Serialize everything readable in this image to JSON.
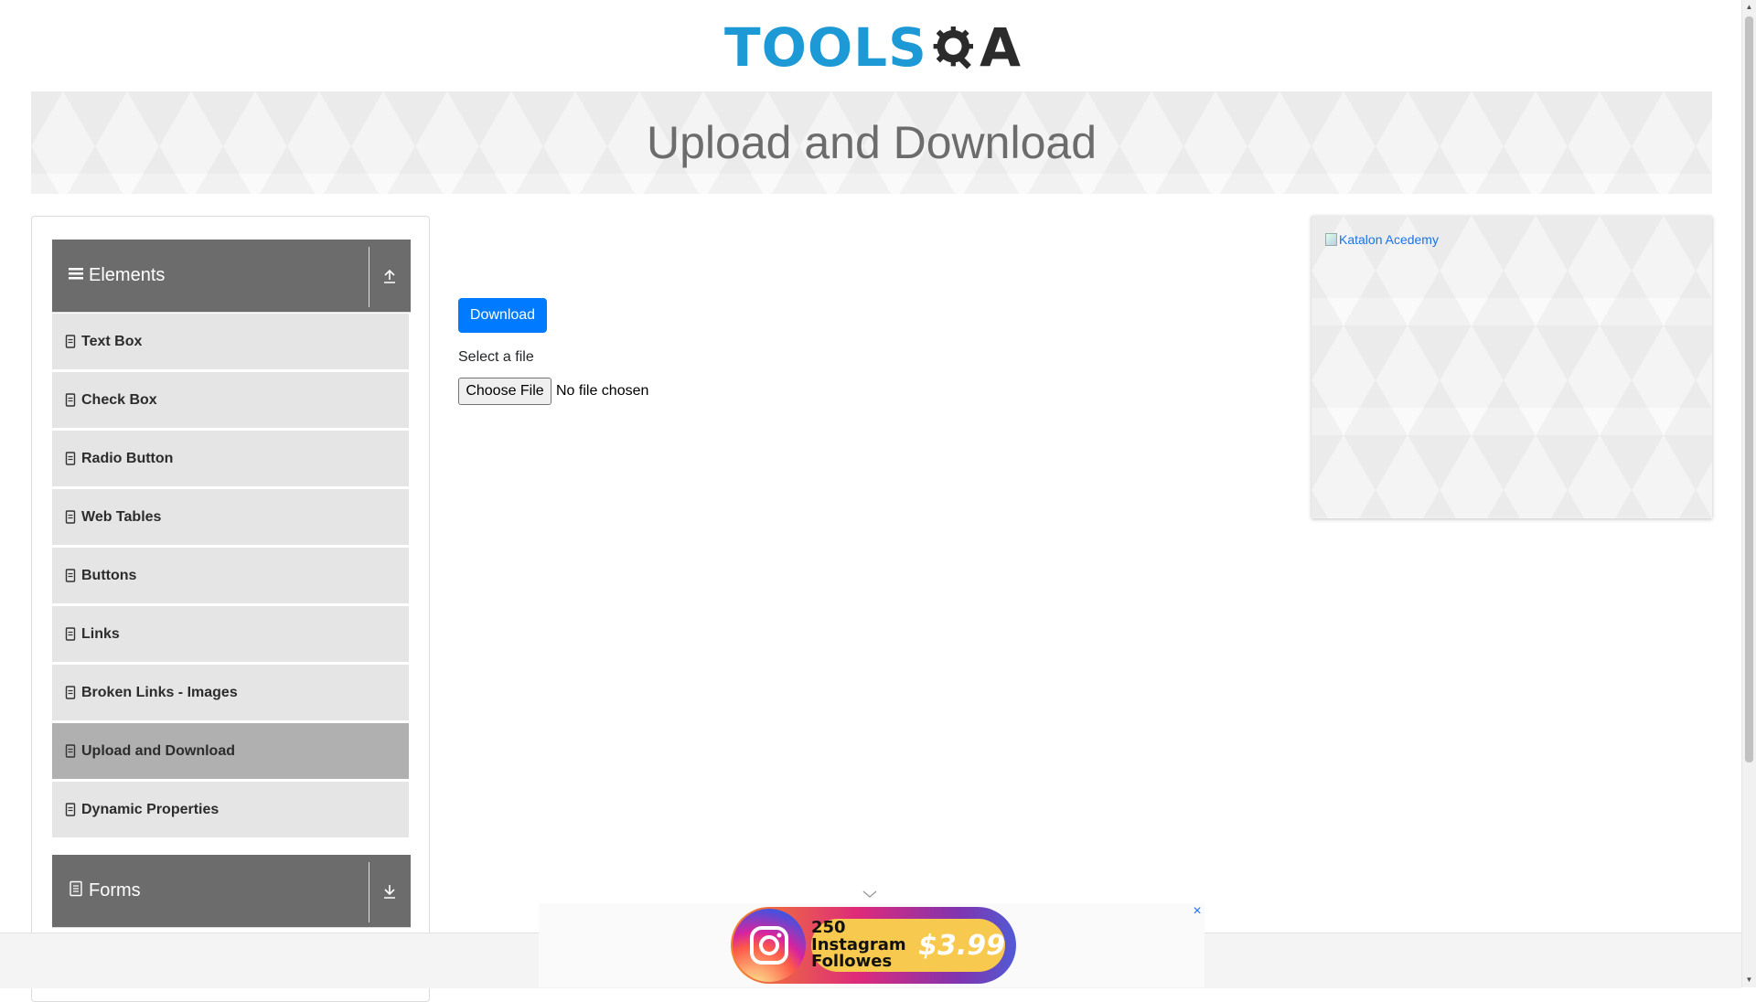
{
  "logo": {
    "text": "TOOLS",
    "suffix": "A",
    "brand_color": "#1d9ad6"
  },
  "banner": {
    "title": "Upload and Download"
  },
  "sidebar": {
    "groups": [
      {
        "label": "Elements",
        "icon": "hamburger-icon",
        "toggle_icon": "upload-arrow-icon",
        "expanded": true
      },
      {
        "label": "Forms",
        "icon": "document-icon",
        "toggle_icon": "download-arrow-icon",
        "expanded": false
      }
    ],
    "items": [
      {
        "label": "Text Box"
      },
      {
        "label": "Check Box"
      },
      {
        "label": "Radio Button"
      },
      {
        "label": "Web Tables"
      },
      {
        "label": "Buttons"
      },
      {
        "label": "Links"
      },
      {
        "label": "Broken Links - Images"
      },
      {
        "label": "Upload and Download",
        "active": true
      },
      {
        "label": "Dynamic Properties"
      }
    ]
  },
  "main": {
    "download_button": "Download",
    "select_label": "Select a file",
    "choose_file_button": "Choose File",
    "file_status": "No file chosen"
  },
  "right_ad": {
    "broken_image_alt": "Katalon Acedemy"
  },
  "bottom_ad": {
    "close_symbol": "×",
    "followers_line1": "250 Instagram",
    "followers_line2": "Followes",
    "price": "$3.99"
  },
  "colors": {
    "accent": "#007bff",
    "group_header": "#6c6c6c",
    "menu_item": "#e5e5e5",
    "menu_item_active": "#b0b0b0"
  }
}
